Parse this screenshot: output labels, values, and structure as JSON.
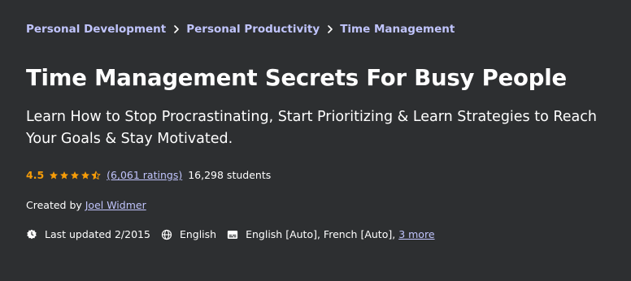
{
  "breadcrumb": {
    "items": [
      {
        "label": "Personal Development"
      },
      {
        "label": "Personal Productivity"
      },
      {
        "label": "Time Management"
      }
    ],
    "separator_icon": "chevron-right-icon"
  },
  "course": {
    "title": "Time Management Secrets For Busy People",
    "subtitle": "Learn How to Stop Procrastinating, Start Prioritizing & Learn Strategies to Reach Your Goals & Stay Motivated.",
    "rating": {
      "value": "4.5",
      "stars_filled": 4.5,
      "stars_total": 5,
      "ratings_link": "(6,061 ratings)",
      "students": "16,298 students"
    },
    "created_by": {
      "label": "Created by",
      "instructor": "Joel Widmer"
    },
    "meta": {
      "last_updated": "Last updated 2/2015",
      "language": "English",
      "captions": "English [Auto], French [Auto],",
      "more_link": "3 more"
    }
  },
  "colors": {
    "background": "#2d2f31",
    "link": "#c0c4fc",
    "rating": "#f69c08",
    "text": "#ffffff"
  }
}
